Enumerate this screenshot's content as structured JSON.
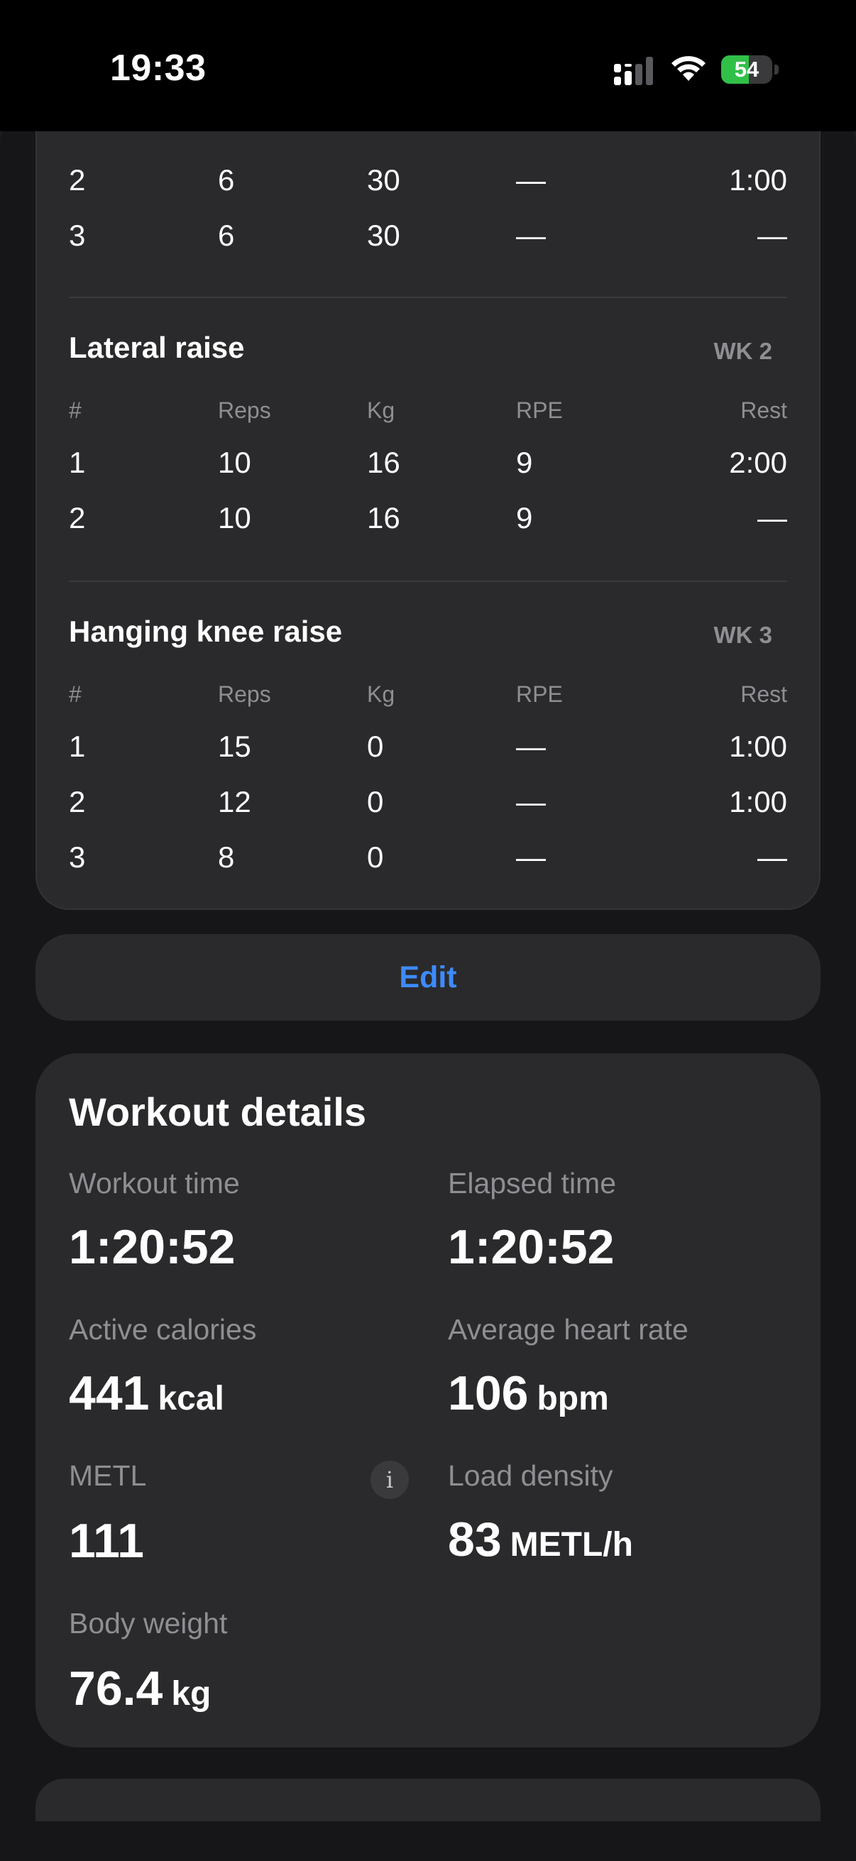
{
  "status_bar": {
    "time": "19:33",
    "battery": "54",
    "battery_level": 0.54
  },
  "exercises": [
    {
      "name": "",
      "week": "",
      "rows": [
        {
          "num": "2",
          "reps": "6",
          "kg": "30",
          "rpe": "—",
          "rest": "1:00"
        },
        {
          "num": "3",
          "reps": "6",
          "kg": "30",
          "rpe": "—",
          "rest": "—"
        }
      ]
    },
    {
      "name": "Lateral raise",
      "week": "WK 2",
      "headers": {
        "num": "#",
        "reps": "Reps",
        "kg": "Kg",
        "rpe": "RPE",
        "rest": "Rest"
      },
      "rows": [
        {
          "num": "1",
          "reps": "10",
          "kg": "16",
          "rpe": "9",
          "rest": "2:00"
        },
        {
          "num": "2",
          "reps": "10",
          "kg": "16",
          "rpe": "9",
          "rest": "—"
        }
      ]
    },
    {
      "name": "Hanging knee raise",
      "week": "WK 3",
      "headers": {
        "num": "#",
        "reps": "Reps",
        "kg": "Kg",
        "rpe": "RPE",
        "rest": "Rest"
      },
      "rows": [
        {
          "num": "1",
          "reps": "15",
          "kg": "0",
          "rpe": "—",
          "rest": "1:00"
        },
        {
          "num": "2",
          "reps": "12",
          "kg": "0",
          "rpe": "—",
          "rest": "1:00"
        },
        {
          "num": "3",
          "reps": "8",
          "kg": "0",
          "rpe": "—",
          "rest": "—"
        }
      ]
    }
  ],
  "edit_label": "Edit",
  "workout_details": {
    "title": "Workout details",
    "workout_time": {
      "label": "Workout time",
      "value": "1:20:52"
    },
    "elapsed_time": {
      "label": "Elapsed time",
      "value": "1:20:52"
    },
    "active_calories": {
      "label": "Active calories",
      "value": "441",
      "unit": "kcal"
    },
    "avg_heart_rate": {
      "label": "Average heart rate",
      "value": "106",
      "unit": "bpm"
    },
    "metl": {
      "label": "METL",
      "value": "111",
      "info": "i"
    },
    "load_density": {
      "label": "Load density",
      "value": "83",
      "unit": "METL/h"
    },
    "body_weight": {
      "label": "Body weight",
      "value": "76.4",
      "unit": "kg"
    }
  },
  "colors": {
    "accent": "#3d8bfd",
    "battery": "#30c048",
    "card": "#2a2a2c",
    "background": "#1c1c1e"
  }
}
